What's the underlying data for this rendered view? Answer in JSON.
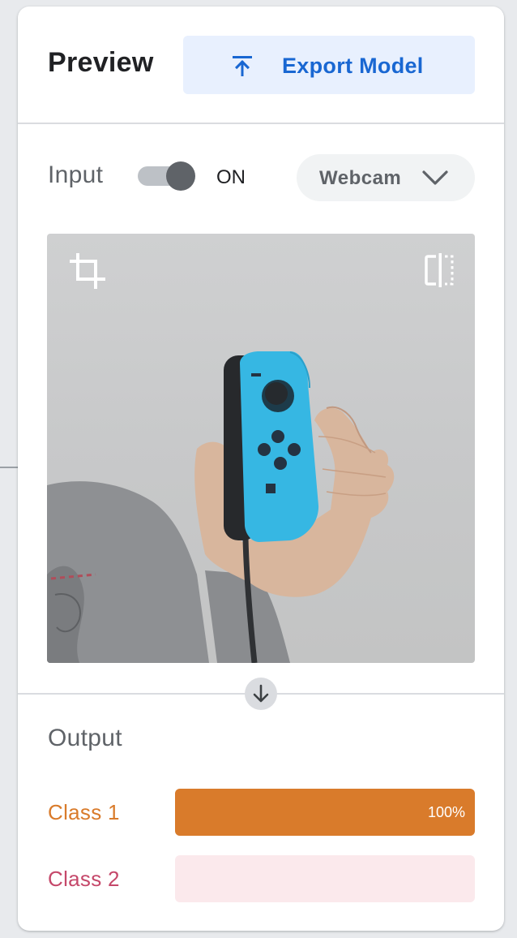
{
  "header": {
    "title": "Preview",
    "export_label": "Export Model",
    "export_icon": "upload-arrow-icon",
    "accent": "#1967d2"
  },
  "input": {
    "label": "Input",
    "toggle_on": true,
    "toggle_state": "ON",
    "source": "Webcam",
    "source_icon": "chevron-down-icon"
  },
  "preview": {
    "crop_icon": "crop-icon",
    "flip_icon": "flip-horizontal-icon"
  },
  "output": {
    "title": "Output",
    "classes": [
      {
        "label": "Class 1",
        "percent": 100,
        "percent_text": "100%",
        "color": "#d97b2b",
        "track": "#fbe6d4"
      },
      {
        "label": "Class 2",
        "percent": 0,
        "percent_text": "",
        "color": "#c5486a",
        "track": "#fbe9ec"
      }
    ]
  }
}
